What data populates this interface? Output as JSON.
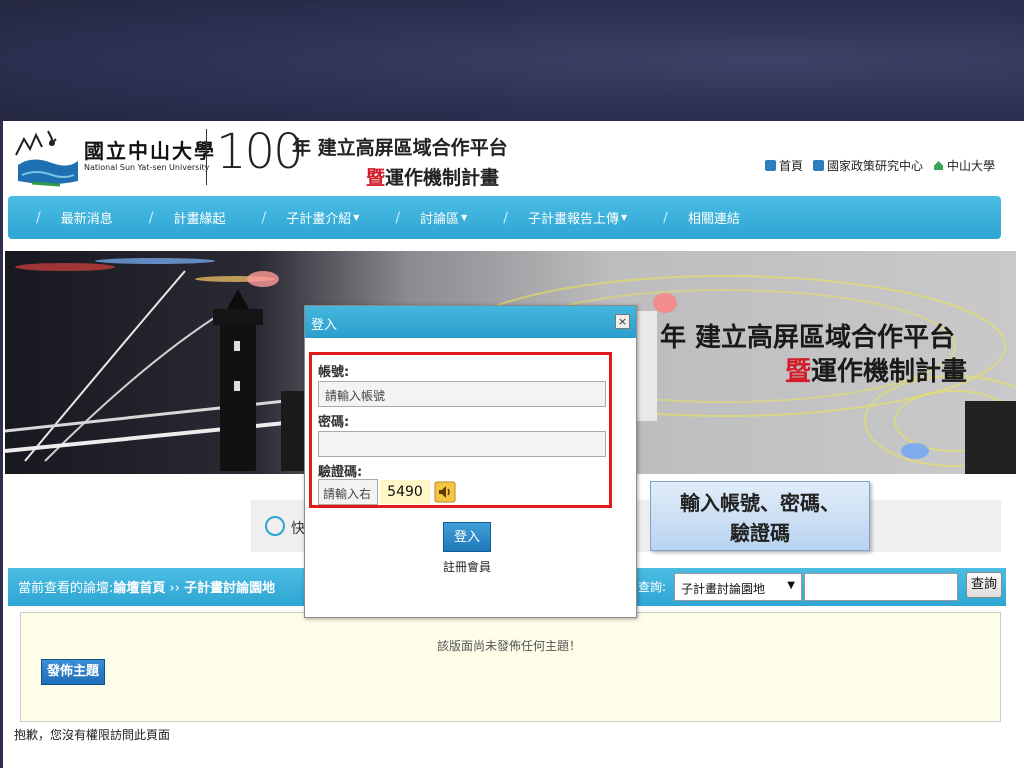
{
  "header": {
    "univ_name": "國立中山大學",
    "univ_en": "National Sun Yat-sen University",
    "year": "100",
    "title_line1": "年 建立高屏區域合作平台",
    "title_line2_hl": "暨",
    "title_line2_rest": "運作機制計畫",
    "toplinks": [
      "首頁",
      "國家政策研究中心",
      "中山大學"
    ]
  },
  "nav": {
    "items": [
      "最新消息",
      "計畫緣起",
      "子計畫介紹",
      "討論區",
      "子計畫報告上傳",
      "相關連結"
    ],
    "separator": "/"
  },
  "banner": {
    "title1": "年 建立高屏區域合作平台",
    "title2_hl": "暨",
    "title2_rest": "運作機制計畫"
  },
  "quick": {
    "text": "快"
  },
  "forum": {
    "crumb_prefix": "當前查看的論壇:",
    "crumb_home": "論壇首頁",
    "crumb_sep": " ›› ",
    "crumb_current": "子計畫討論園地",
    "query_label": "查詢:",
    "select_value": "子計畫討論園地",
    "search_button": "查詢"
  },
  "content": {
    "empty_msg": "該版面尚未發佈任何主題！",
    "post_button": "發佈主題"
  },
  "no_permission": "抱歉，您沒有權限訪問此頁面",
  "login_modal": {
    "title": "登入",
    "close": "×",
    "account_label": "帳號:",
    "account_placeholder": "請輸入帳號",
    "password_label": "密碼:",
    "captcha_label": "驗證碼:",
    "captcha_placeholder": "請輸入右",
    "captcha_code": "5490",
    "login_button": "登入",
    "register_link": "註冊會員"
  },
  "callout": {
    "line1": "輸入帳號、密碼、",
    "line2": "驗證碼"
  },
  "colors": {
    "nav_blue": "#2ea5d3",
    "highlight_red": "#d21e2b",
    "annotation_red": "#e01a1a",
    "top_band": "#2d3052"
  }
}
